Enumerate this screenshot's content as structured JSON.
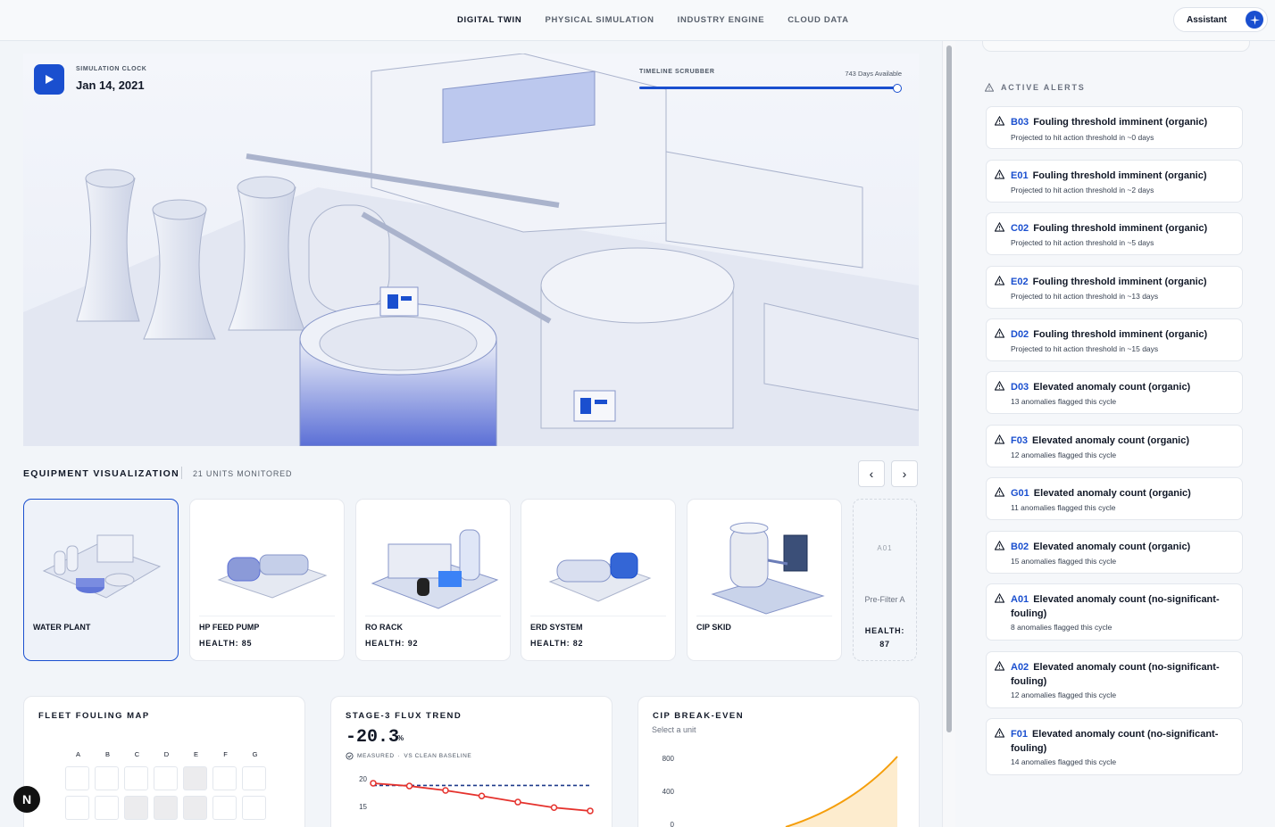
{
  "nav": {
    "tabs": [
      "DIGITAL TWIN",
      "PHYSICAL SIMULATION",
      "INDUSTRY ENGINE",
      "CLOUD DATA"
    ],
    "active": "DIGITAL TWIN",
    "assistant_label": "Assistant"
  },
  "hero": {
    "clock_label": "SIMULATION CLOCK",
    "clock_date": "Jan 14, 2021",
    "scrubber_label": "TIMELINE SCRUBBER",
    "days_available": "743 Days Available",
    "scrubber_progress": 1.0
  },
  "equipment": {
    "title": "EQUIPMENT VISUALIZATION",
    "count": "21 UNITS MONITORED",
    "cards": [
      {
        "name": "WATER PLANT",
        "health": ""
      },
      {
        "name": "HP FEED PUMP",
        "health": "HEALTH: 85"
      },
      {
        "name": "RO RACK",
        "health": "HEALTH: 92"
      },
      {
        "name": "ERD SYSTEM",
        "health": "HEALTH: 82"
      },
      {
        "name": "CIP SKID",
        "health": ""
      }
    ],
    "ghost": {
      "code": "A01",
      "name": "Pre-Filter A",
      "health_label": "HEALTH:",
      "health_value": "87"
    }
  },
  "fleet": {
    "title": "FLEET FOULING MAP",
    "columns": [
      "A",
      "B",
      "C",
      "D",
      "E",
      "F",
      "G"
    ]
  },
  "flux": {
    "title": "STAGE-3 FLUX TREND",
    "value": "-20.3",
    "unit": "%",
    "measured": "MEASURED",
    "baseline": "VS CLEAN BASELINE",
    "y_ticks": [
      "20",
      "15"
    ],
    "measured_values": [
      19.2,
      18.7,
      17.9,
      16.9,
      15.8,
      14.8,
      14.2
    ],
    "baseline_value": 18.8,
    "colors": {
      "measured": "#e5322d",
      "baseline": "#1e3a8a"
    }
  },
  "cip": {
    "title": "CIP BREAK-EVEN",
    "subtitle": "Select a unit",
    "y_ticks": [
      "800",
      "400",
      "0"
    ],
    "color": "#f59e0b"
  },
  "alerts": {
    "title": "ACTIVE ALERTS",
    "items": [
      {
        "code": "B03",
        "title": "Fouling threshold imminent (organic)",
        "sub": "Projected to hit action threshold in ~0 days"
      },
      {
        "code": "E01",
        "title": "Fouling threshold imminent (organic)",
        "sub": "Projected to hit action threshold in ~2 days"
      },
      {
        "code": "C02",
        "title": "Fouling threshold imminent (organic)",
        "sub": "Projected to hit action threshold in ~5 days"
      },
      {
        "code": "E02",
        "title": "Fouling threshold imminent (organic)",
        "sub": "Projected to hit action threshold in ~13 days"
      },
      {
        "code": "D02",
        "title": "Fouling threshold imminent (organic)",
        "sub": "Projected to hit action threshold in ~15 days"
      },
      {
        "code": "D03",
        "title": "Elevated anomaly count (organic)",
        "sub": "13 anomalies flagged this cycle"
      },
      {
        "code": "F03",
        "title": "Elevated anomaly count (organic)",
        "sub": "12 anomalies flagged this cycle"
      },
      {
        "code": "G01",
        "title": "Elevated anomaly count (organic)",
        "sub": "11 anomalies flagged this cycle"
      },
      {
        "code": "B02",
        "title": "Elevated anomaly count (organic)",
        "sub": "15 anomalies flagged this cycle"
      },
      {
        "code": "A01",
        "title": "Elevated anomaly count (no-significant-fouling)",
        "sub": "8 anomalies flagged this cycle"
      },
      {
        "code": "A02",
        "title": "Elevated anomaly count (no-significant-fouling)",
        "sub": "12 anomalies flagged this cycle"
      },
      {
        "code": "F01",
        "title": "Elevated anomaly count (no-significant-fouling)",
        "sub": "14 anomalies flagged this cycle"
      }
    ]
  },
  "colors": {
    "accent": "#1a4fcf"
  }
}
